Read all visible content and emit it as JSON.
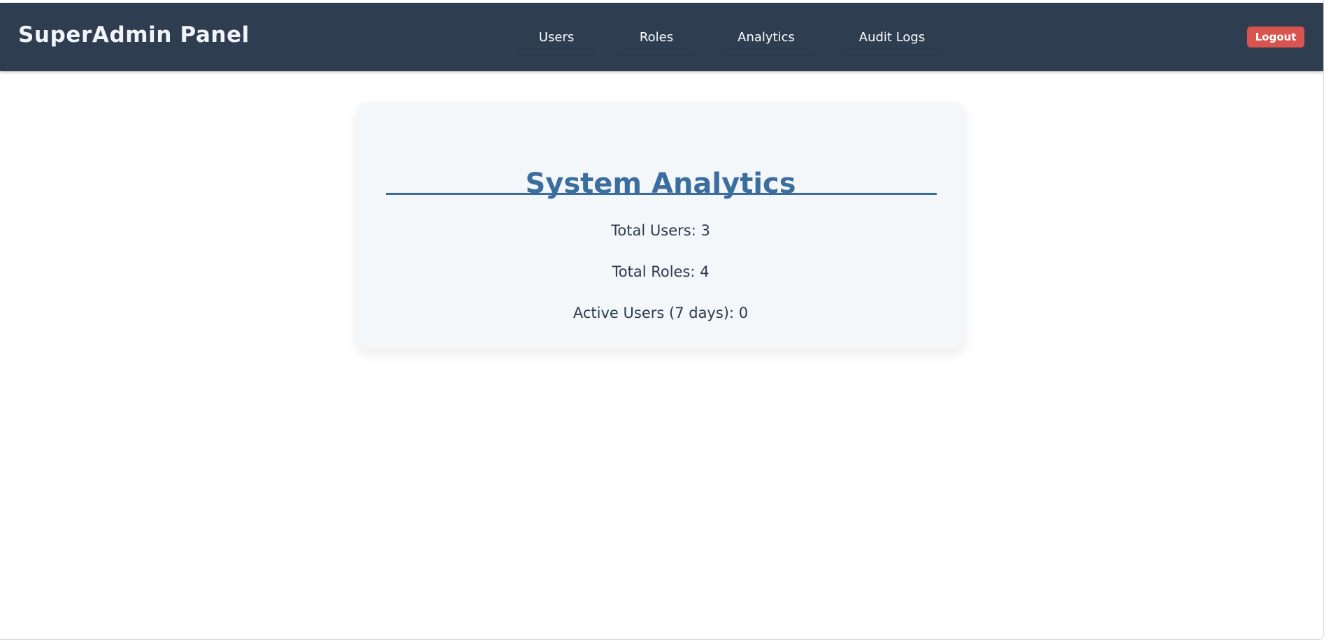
{
  "header": {
    "brand": "SuperAdmin Panel",
    "nav": [
      {
        "label": "Users"
      },
      {
        "label": "Roles"
      },
      {
        "label": "Analytics"
      },
      {
        "label": "Audit Logs"
      }
    ],
    "logout_label": "Logout"
  },
  "analytics": {
    "title": "System Analytics",
    "stats": [
      {
        "text": "Total Users: 3"
      },
      {
        "text": "Total Roles: 4"
      },
      {
        "text": "Active Users (7 days): 0"
      }
    ]
  },
  "colors": {
    "header_background": "#2f3d50",
    "accent": "#3b6d9f",
    "logout_background": "#d9534f",
    "card_background": "#f4f7fa"
  }
}
